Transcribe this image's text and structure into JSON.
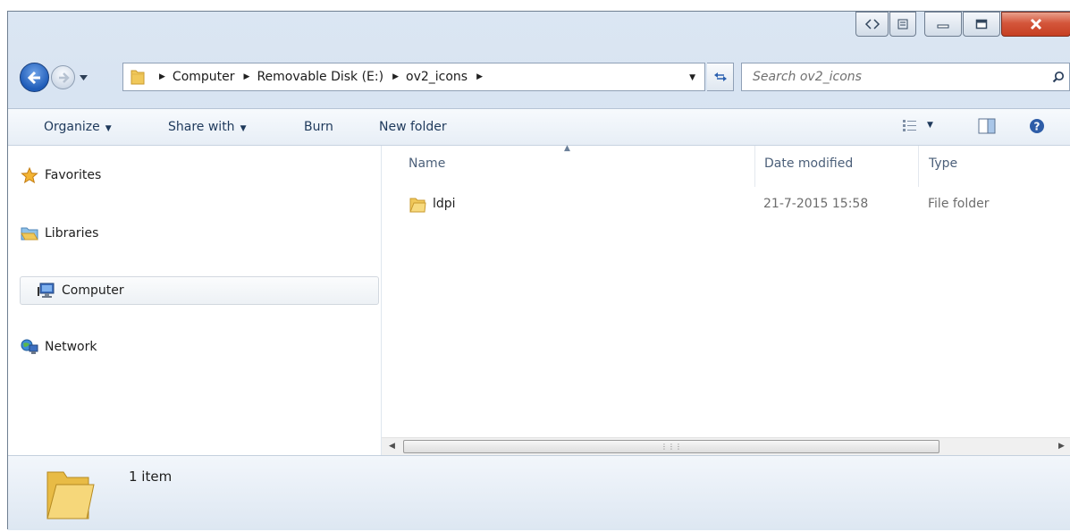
{
  "window": {
    "caption_buttons": [
      "back-forward-toggle-icon",
      "restore-icon",
      "minimize-icon",
      "maximize-icon",
      "close-icon"
    ]
  },
  "address": {
    "breadcrumbs": [
      "Computer",
      "Removable Disk (E:)",
      "ov2_icons"
    ]
  },
  "search": {
    "placeholder": "Search ov2_icons"
  },
  "toolbar": {
    "organize": "Organize",
    "share_with": "Share with",
    "burn": "Burn",
    "new_folder": "New folder"
  },
  "nav": {
    "items": [
      {
        "label": "Favorites",
        "icon": "star-icon"
      },
      {
        "label": "Libraries",
        "icon": "libraries-icon"
      },
      {
        "label": "Computer",
        "icon": "computer-icon",
        "selected": true
      },
      {
        "label": "Network",
        "icon": "network-icon"
      }
    ]
  },
  "columns": {
    "name": "Name",
    "date_modified": "Date modified",
    "type": "Type"
  },
  "files": [
    {
      "name": "ldpi",
      "date_modified": "21-7-2015 15:58",
      "type": "File folder"
    }
  ],
  "status": {
    "item_count": "1 item"
  },
  "colors": {
    "accent": "#1e395b",
    "folder": "#f0c85a"
  }
}
